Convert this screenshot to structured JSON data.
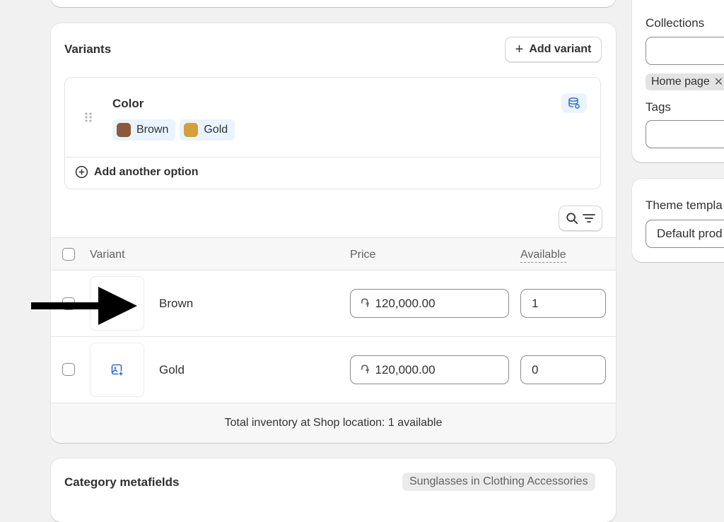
{
  "variants": {
    "title": "Variants",
    "add_variant_label": "Add variant",
    "option": {
      "name": "Color",
      "values": [
        {
          "label": "Brown",
          "color": "#8b5a3c"
        },
        {
          "label": "Gold",
          "color": "#d4a03a"
        }
      ]
    },
    "add_option_label": "Add another option",
    "table": {
      "col_variant": "Variant",
      "col_price": "Price",
      "col_available": "Available",
      "rows": [
        {
          "name": "Brown",
          "currency": "֏",
          "price": "120,000.00",
          "available": "1"
        },
        {
          "name": "Gold",
          "currency": "֏",
          "price": "120,000.00",
          "available": "0"
        }
      ]
    },
    "total_inventory": "Total inventory at Shop location: 1 available"
  },
  "category_metafields": {
    "title": "Category metafields",
    "badge": "Sunglasses in Clothing Accessories"
  },
  "sidebar": {
    "collections_label": "Collections",
    "collection_tag": "Home page",
    "tags_label": "Tags",
    "theme_template_label": "Theme templa",
    "theme_template_value": "Default prod"
  },
  "colors": {
    "accent_blue": "#2c6ecb",
    "chip_bg": "#eaf4ff"
  }
}
